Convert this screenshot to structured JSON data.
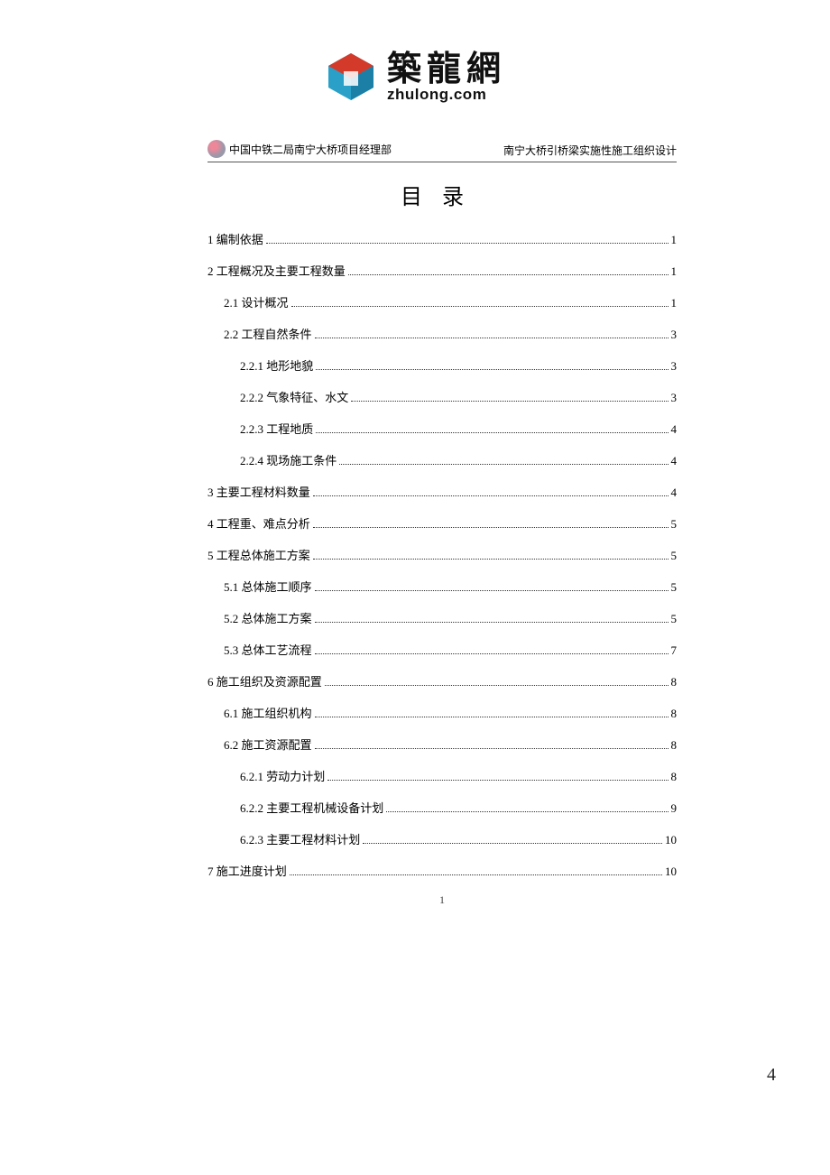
{
  "site": {
    "logo_cn": "築龍網",
    "logo_en": "zhulong.com"
  },
  "doc_header": {
    "left": "中国中铁二局南宁大桥项目经理部",
    "right": "南宁大桥引桥梁实施性施工组织设计"
  },
  "toc_title": "目录",
  "toc": [
    {
      "label": "1 编制依据",
      "page": "1",
      "indent": 0
    },
    {
      "label": "2 工程概况及主要工程数量",
      "page": "1",
      "indent": 0
    },
    {
      "label": "2.1 设计概况",
      "page": "1",
      "indent": 1
    },
    {
      "label": "2.2 工程自然条件",
      "page": "3",
      "indent": 1
    },
    {
      "label": "2.2.1 地形地貌",
      "page": "3",
      "indent": 2
    },
    {
      "label": "2.2.2 气象特征、水文",
      "page": "3",
      "indent": 2
    },
    {
      "label": "2.2.3 工程地质",
      "page": "4",
      "indent": 2
    },
    {
      "label": "2.2.4 现场施工条件",
      "page": "4",
      "indent": 2
    },
    {
      "label": "3 主要工程材料数量",
      "page": "4",
      "indent": 0
    },
    {
      "label": "4 工程重、难点分析",
      "page": "5",
      "indent": 0
    },
    {
      "label": "5 工程总体施工方案",
      "page": "5",
      "indent": 0
    },
    {
      "label": "5.1 总体施工顺序",
      "page": "5",
      "indent": 1
    },
    {
      "label": "5.2 总体施工方案",
      "page": "5",
      "indent": 1
    },
    {
      "label": "5.3 总体工艺流程",
      "page": "7",
      "indent": 1
    },
    {
      "label": "6 施工组织及资源配置",
      "page": "8",
      "indent": 0
    },
    {
      "label": "6.1 施工组织机构",
      "page": "8",
      "indent": 1
    },
    {
      "label": "6.2 施工资源配置",
      "page": "8",
      "indent": 1
    },
    {
      "label": "6.2.1 劳动力计划",
      "page": "8",
      "indent": 2
    },
    {
      "label": "6.2.2 主要工程机械设备计划",
      "page": "9",
      "indent": 2
    },
    {
      "label": "6.2.3 主要工程材料计划",
      "page": "10",
      "indent": 2
    },
    {
      "label": "7 施工进度计划",
      "page": "10",
      "indent": 0
    }
  ],
  "footer_page_inner": "1",
  "corner_page": "4"
}
